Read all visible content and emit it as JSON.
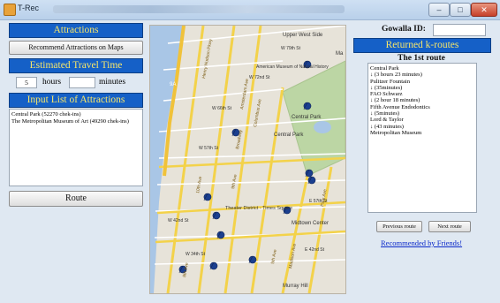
{
  "window": {
    "title": "T-Rec",
    "minimize": "–",
    "maximize": "□",
    "close": "✕"
  },
  "left": {
    "attractions_header": "Attractions",
    "recommend_button": "Recommend Attractions on Maps",
    "travel_time_header": "Estimated Travel Time",
    "hours_value": "5",
    "hours_label": "hours",
    "minutes_value": "",
    "minutes_label": "minutes",
    "input_list_header": "Input List of Attractions",
    "input_list": [
      "Central Park (52270 chek-ins)",
      "The Metropolitan Museum of Art (49290 chek-ins)"
    ],
    "route_button": "Route"
  },
  "right": {
    "gowalla_label": "Gowalla ID:",
    "gowalla_value": "",
    "returned_header": "Returned k-routes",
    "route_title": "The 1st route",
    "route_lines": [
      "Central Park",
      "↓ (3 hours 23 minutes)",
      "Pulitzer Fountain",
      "↓ (35minutes)",
      "FAO Schwarz",
      "↓ (2 hour 18 minutes)",
      "Fifth Avenue Endodontics",
      "↓ (5minutes)",
      "Lord & Taylor",
      "↓ (43 minutes)",
      "Metropolitan Museum"
    ],
    "prev_button": "Previous route",
    "next_button": "Next route",
    "friends_link": "Recommended by Friends!"
  },
  "map_labels": {
    "upper_west_side": "Upper West Side",
    "museum": "American Museum of Natural History",
    "central_park": "Central Park",
    "central_park_2": "Central Park",
    "midtown": "Midtown Center",
    "theater_district": "Theater District - Times Square",
    "murray_hill": "Murray Hill",
    "henry_hudson": "Henry Hudson Pkwy",
    "w79": "W 79th St",
    "w72": "W 72nd St",
    "w66": "W 66th St",
    "w57": "W 57th St",
    "w42": "W 42nd St",
    "w34": "W 34th St",
    "e57": "E 57th St",
    "e42": "E 42nd St",
    "ma": "Ma",
    "amsterdam": "Amsterdam Ave",
    "columbus": "Columbus Ave",
    "broadway": "Broadway",
    "tenth": "10th Ave",
    "ninth": "9th Ave",
    "eighth": "8th Ave",
    "fifth": "5th Ave",
    "madison": "Madison Ave",
    "park": "Park Ave",
    "hwy": "9A"
  },
  "colors": {
    "header_bg": "#1560c7",
    "header_text": "#f7e66a",
    "link": "#0a28c9",
    "pin": "#1b3f8f"
  }
}
